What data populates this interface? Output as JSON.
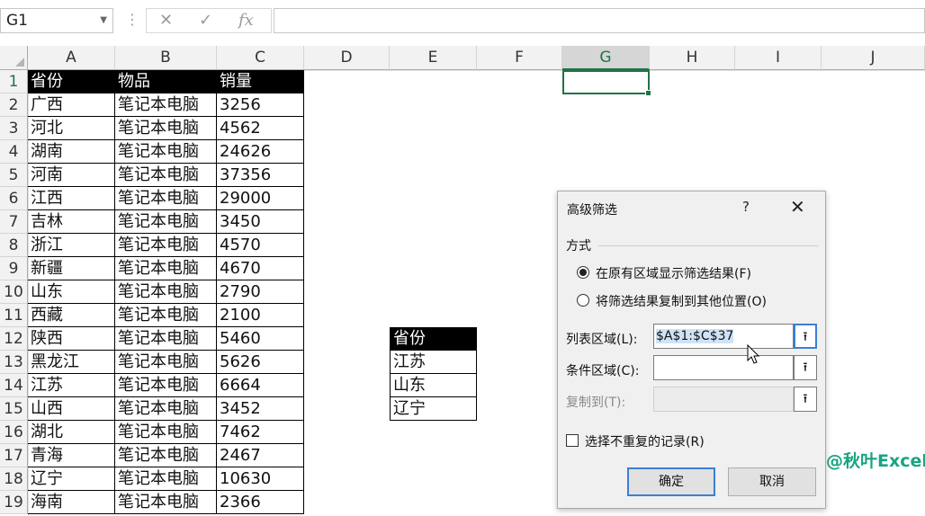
{
  "formula_bar": {
    "name_box": "G1",
    "cancel_icon": "✕",
    "enter_icon": "✓",
    "fx_icon": "fx",
    "formula": ""
  },
  "columns": [
    "A",
    "B",
    "C",
    "D",
    "E",
    "F",
    "G",
    "H",
    "I",
    "J"
  ],
  "selected_column": "G",
  "rows": [
    "1",
    "2",
    "3",
    "4",
    "5",
    "6",
    "7",
    "8",
    "9",
    "10",
    "11",
    "12",
    "13",
    "14",
    "15",
    "16",
    "17",
    "18",
    "19"
  ],
  "table": {
    "headers": [
      "省份",
      "物品",
      "销量"
    ],
    "data": [
      [
        "广西",
        "笔记本电脑",
        "3256"
      ],
      [
        "河北",
        "笔记本电脑",
        "4562"
      ],
      [
        "湖南",
        "笔记本电脑",
        "24626"
      ],
      [
        "河南",
        "笔记本电脑",
        "37356"
      ],
      [
        "江西",
        "笔记本电脑",
        "29000"
      ],
      [
        "吉林",
        "笔记本电脑",
        "3450"
      ],
      [
        "浙江",
        "笔记本电脑",
        "4570"
      ],
      [
        "新疆",
        "笔记本电脑",
        "4670"
      ],
      [
        "山东",
        "笔记本电脑",
        "2790"
      ],
      [
        "西藏",
        "笔记本电脑",
        "2100"
      ],
      [
        "陕西",
        "笔记本电脑",
        "5460"
      ],
      [
        "黑龙江",
        "笔记本电脑",
        "5626"
      ],
      [
        "江苏",
        "笔记本电脑",
        "6664"
      ],
      [
        "山西",
        "笔记本电脑",
        "3452"
      ],
      [
        "湖北",
        "笔记本电脑",
        "7462"
      ],
      [
        "青海",
        "笔记本电脑",
        "2467"
      ],
      [
        "辽宁",
        "笔记本电脑",
        "10630"
      ],
      [
        "海南",
        "笔记本电脑",
        "2366"
      ]
    ]
  },
  "criteria": {
    "header": "省份",
    "values": [
      "江苏",
      "山东",
      "辽宁"
    ]
  },
  "watermark": "@秋叶Excel",
  "dialog": {
    "title": "高级筛选",
    "help": "?",
    "close": "✕",
    "group_label": "方式",
    "option1": "在原有区域显示筛选结果(F)",
    "option2": "将筛选结果复制到其他位置(O)",
    "list_range_label": "列表区域(L):",
    "list_range_value": "$A$1:$C$37",
    "criteria_range_label": "条件区域(C):",
    "criteria_range_value": "",
    "copy_to_label": "复制到(T):",
    "copy_to_value": "",
    "range_button_icon": "⭱",
    "unique_label": "选择不重复的记录(R)",
    "ok_label": "确定",
    "cancel_label": "取消"
  }
}
